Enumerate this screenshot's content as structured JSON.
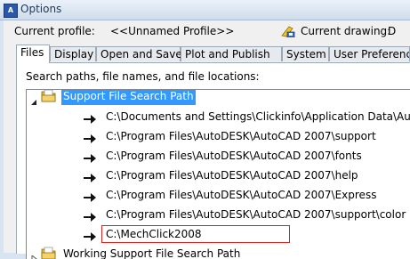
{
  "window": {
    "title": "Options"
  },
  "profile": {
    "current_profile_label": "Current profile:",
    "current_profile_value": "<<Unnamed Profile>>",
    "current_drawing_label": "Current drawing:",
    "current_drawing_value": "D"
  },
  "tabs": [
    {
      "label": "Files",
      "active": true
    },
    {
      "label": "Display"
    },
    {
      "label": "Open and Save"
    },
    {
      "label": "Plot and Publish"
    },
    {
      "label": "System"
    },
    {
      "label": "User Preference"
    }
  ],
  "files_tab": {
    "caption": "Search paths, file names, and file locations:",
    "support_node_label": "Support File Search Path",
    "paths": [
      "C:\\Documents and Settings\\Clickinfo\\Application Data\\Auto",
      "C:\\Program Files\\AutoDESK\\AutoCAD 2007\\support",
      "C:\\Program Files\\AutoDESK\\AutoCAD 2007\\fonts",
      "C:\\Program Files\\AutoDESK\\AutoCAD 2007\\help",
      "C:\\Program Files\\AutoDESK\\AutoCAD 2007\\Express",
      "C:\\Program Files\\AutoDESK\\AutoCAD 2007\\support\\color",
      "C:\\MechClick2008"
    ],
    "working_node_label": "Working Support File Search Path"
  },
  "colors": {
    "selection": "#3399ff",
    "highlight_border": "#e21d1d"
  }
}
